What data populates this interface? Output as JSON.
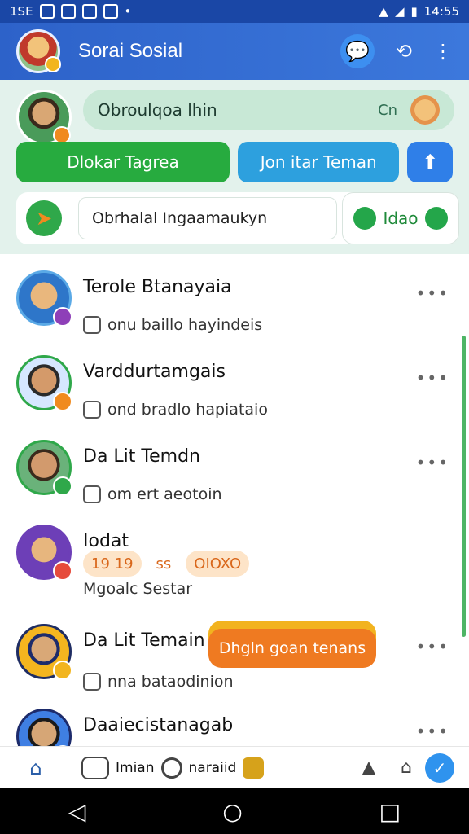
{
  "status_bar": {
    "left_text": "1SE",
    "time": "14:55"
  },
  "app_bar": {
    "title": "Sorai Sosial",
    "icons": [
      "chat-icon",
      "share-icon",
      "more-vertical-icon"
    ]
  },
  "top_panel": {
    "bubble_text": "Obroulqoa lhin",
    "bubble_right_text": "Cn",
    "buttons": {
      "primary": "Dlokar Tagrea",
      "secondary": "Jon itar Teman",
      "icon": "share-up-icon"
    },
    "input_text": "Obrhalal Ingaamaukyn",
    "location_label": "Idao"
  },
  "list": [
    {
      "name": "Terole Btanayaia",
      "sub": "onu baillo hayindeis"
    },
    {
      "name": "Varddurtamgais",
      "sub": "ond bradlo hapiataio"
    },
    {
      "name": "Da Lit Temdn",
      "sub": "om ert aeotoin"
    },
    {
      "name": "Iodat",
      "sub": "Mgoalc Sestar",
      "chips": [
        "19 19",
        "ss",
        "OIOXO"
      ]
    },
    {
      "name": "Da Lit Temain",
      "sub": "nna bataodinion"
    },
    {
      "name": "Daaiecistanagab",
      "sub": ""
    }
  ],
  "toast_text": "Dhgln goan tenans",
  "bottom_nav": {
    "mid_label_1": "Imian",
    "mid_label_2": "naraiid",
    "icons": [
      "home-icon",
      "tab-icon",
      "search-icon",
      "cup-icon",
      "person-icon",
      "profile-icon",
      "check-icon"
    ]
  },
  "colors": {
    "app_bar": "#2d62c9",
    "accent_green": "#27ab3f",
    "accent_blue": "#2da0de",
    "accent_orange": "#ef7a21"
  }
}
